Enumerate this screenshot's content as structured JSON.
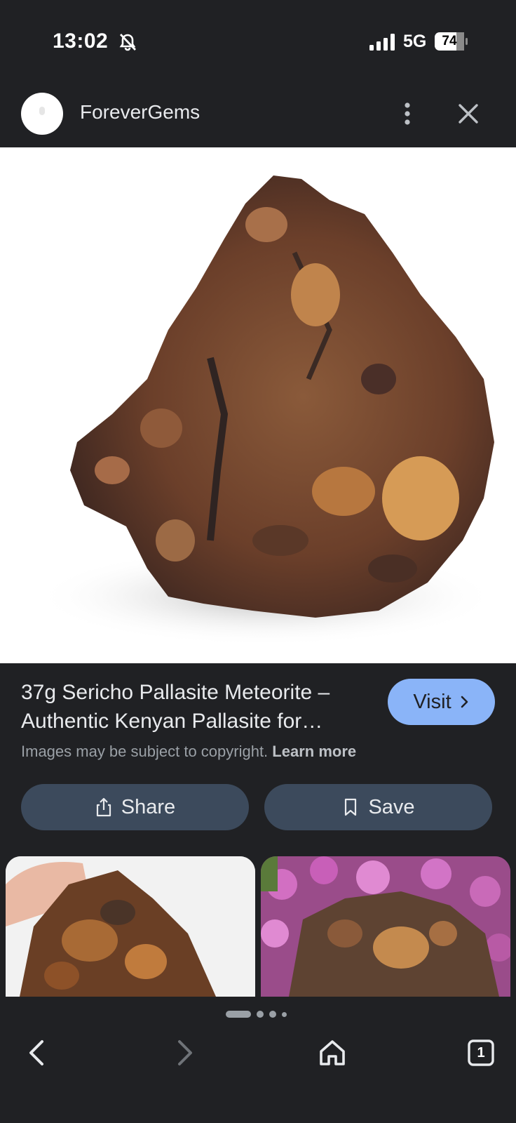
{
  "status_bar": {
    "time": "13:02",
    "network": "5G",
    "battery": "74",
    "icons": [
      "bell-off-icon",
      "signal-icon",
      "battery-icon"
    ]
  },
  "header": {
    "source_name": "ForeverGems",
    "icons": [
      "more-vert-icon",
      "close-icon"
    ]
  },
  "result": {
    "title": "37g Sericho Pallasite Meteorite – Authentic Kenyan Pallasite for…",
    "visit_label": "Visit",
    "copyright_text": "Images may be subject to copyright.",
    "learn_more": "Learn more"
  },
  "actions": {
    "share_label": "Share",
    "save_label": "Save"
  },
  "bottom_nav": {
    "tab_count": "1",
    "icons": [
      "back-icon",
      "forward-icon",
      "home-icon",
      "tabs-icon"
    ]
  },
  "colors": {
    "background": "#202124",
    "accent": "#8ab4f8",
    "button": "#3c4a5c",
    "text": "#e8eaed",
    "muted": "#9aa0a6"
  }
}
